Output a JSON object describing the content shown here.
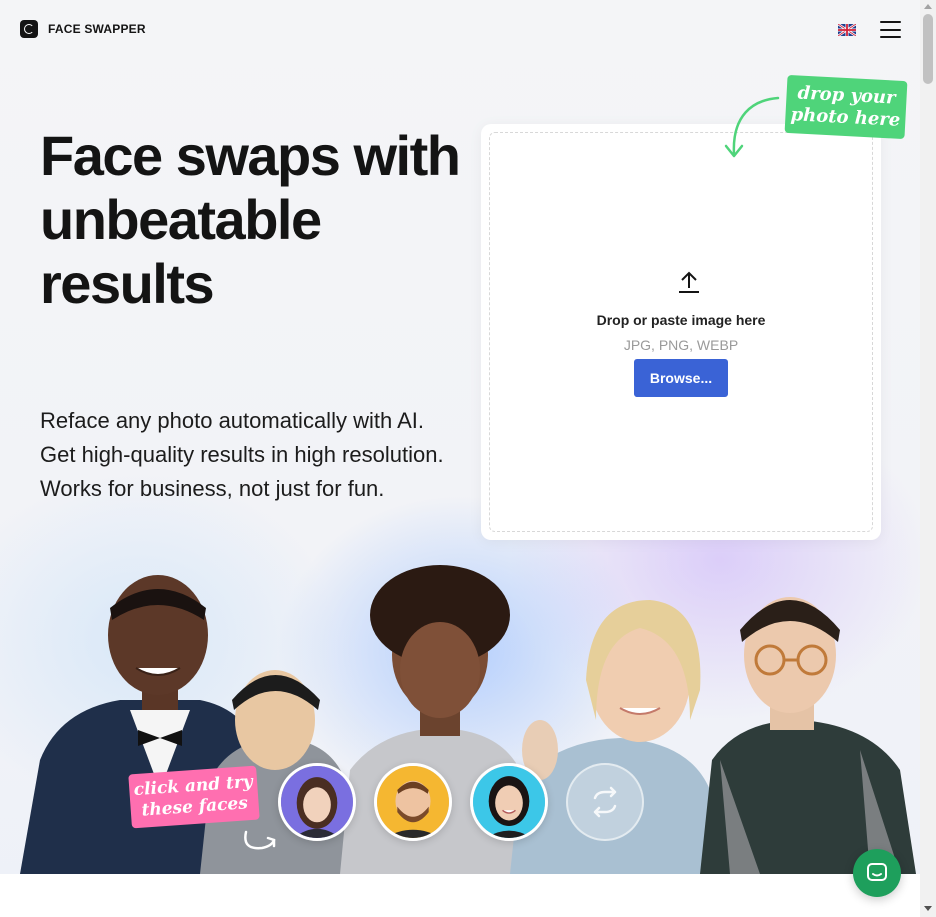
{
  "brand": {
    "name": "FACE SWAPPER",
    "logo_icon": "face-swapper-logo-icon"
  },
  "header": {
    "language_icon": "uk-flag-icon",
    "menu_icon": "hamburger-menu-icon"
  },
  "hero": {
    "title": "Face swaps with unbeatable results",
    "subtitle": "Reface any photo automatically with AI. Get high-quality results in high resolution. Works for business, not just for fun."
  },
  "dropzone": {
    "sticker_line1": "drop your",
    "sticker_line2": "photo here",
    "upload_icon": "upload-arrow-icon",
    "title": "Drop or paste image here",
    "formats": "JPG, PNG, WEBP",
    "browse_label": "Browse..."
  },
  "faces": {
    "sticker_line1": "click and try",
    "sticker_line2": "these faces",
    "items": [
      {
        "name": "face-woman-purple",
        "bg": "#7a6fe0"
      },
      {
        "name": "face-man-yellow",
        "bg": "#f5b731"
      },
      {
        "name": "face-woman-cyan",
        "bg": "#3cc7e8"
      }
    ],
    "swap_icon": "swap-cycle-icon"
  },
  "chat": {
    "icon": "chat-bubble-icon",
    "color": "#1e9f5c"
  },
  "colors": {
    "primary": "#3a63d6",
    "sticker_green": "#4fd47a",
    "sticker_pink": "#ff6fb0"
  }
}
